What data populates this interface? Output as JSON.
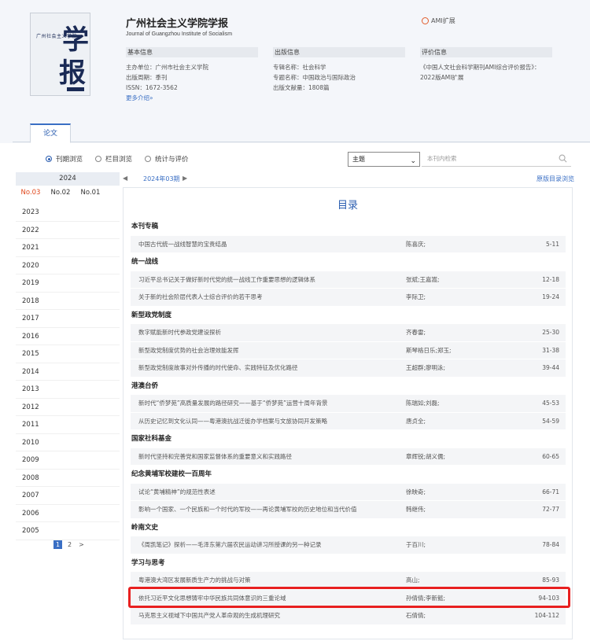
{
  "journal": {
    "title": "广州社会主义学院学报",
    "subtitle": "Journal of Guangzhou Institute of Socialism",
    "cover_text": "广州社会主义学院",
    "cover_big1": "学",
    "cover_big2": "报",
    "ami_label": "AMI扩展"
  },
  "info": {
    "basic": {
      "heading": "基本信息",
      "sponsor": "主办单位：广州市社会主义学院",
      "cycle": "出版周期：季刊",
      "issn": "ISSN：1672-3562",
      "more": "更多介绍»"
    },
    "publish": {
      "heading": "出版信息",
      "field": "专辑名称：社会科学",
      "topic": "专题名称：中国政治与国际政治",
      "count": "出版文献量：1808篇"
    },
    "eval": {
      "heading": "评价信息",
      "line1": "《中国人文社会科学期刊AMI综合评价报告》：",
      "line2": "2022版AMI扩展"
    }
  },
  "tabs": {
    "papers": "论文"
  },
  "view_options": {
    "by_issue": "刊期浏览",
    "by_column": "栏目浏览",
    "stats": "统计与评价"
  },
  "search": {
    "select_value": "主题",
    "placeholder": "本刊内检索"
  },
  "years": {
    "current": "2024",
    "issues": [
      "No.03",
      "No.02",
      "No.01"
    ],
    "list": [
      "2023",
      "2022",
      "2021",
      "2020",
      "2019",
      "2018",
      "2017",
      "2016",
      "2015",
      "2014",
      "2013",
      "2012",
      "2011",
      "2010",
      "2009",
      "2008",
      "2007",
      "2006",
      "2005"
    ],
    "pages": [
      "1",
      "2",
      ">"
    ]
  },
  "issue_nav": {
    "prev": "◀",
    "current": "2024年03期",
    "next": "▶",
    "original": "原版目录浏览"
  },
  "toc": {
    "title": "目录",
    "sections": [
      {
        "name": "本刊专稿",
        "articles": [
          {
            "title": "中国古代统一战线智慧的宝贵结晶",
            "authors": "陈喜庆;",
            "pages": "5-11"
          }
        ]
      },
      {
        "name": "统一战线",
        "articles": [
          {
            "title": "习近平总书记关于做好新时代党的统一战线工作重要思想的逻辑体系",
            "authors": "张斌;王嘉嵩;",
            "pages": "12-18"
          },
          {
            "title": "关于新的社会阶层代表人士综合评价的若干思考",
            "authors": "李际卫;",
            "pages": "19-24"
          }
        ]
      },
      {
        "name": "新型政党制度",
        "articles": [
          {
            "title": "数字赋能新时代参政党建设探析",
            "authors": "齐春雷;",
            "pages": "25-30"
          },
          {
            "title": "新型政党制度优势的社会治理效能发挥",
            "authors": "斯琴格日乐;郑玉;",
            "pages": "31-38"
          },
          {
            "title": "新型政党制度故事对外传播的时代使命、实践特征及优化路径",
            "authors": "王超群;廖明泳;",
            "pages": "39-44"
          }
        ]
      },
      {
        "name": "港澳台侨",
        "articles": [
          {
            "title": "新时代“侨梦苑”高质量发展的路径研究——基于“侨梦苑”运营十周年背景",
            "authors": "陈瑞如;刘磊;",
            "pages": "45-53"
          },
          {
            "title": "从历史记忆到文化认同——粤港澳抗战迁徙办学档案与文旅协同开发策略",
            "authors": "唐贞全;",
            "pages": "54-59"
          }
        ]
      },
      {
        "name": "国家社科基金",
        "articles": [
          {
            "title": "新时代坚持和完善党和国家监督体系的重要意义和实践路径",
            "authors": "章辉锐;胡义儒;",
            "pages": "60-65"
          }
        ]
      },
      {
        "name": "纪念黄埔军校建校一百周年",
        "articles": [
          {
            "title": "试论“黄埔精神”的规范性表述",
            "authors": "徐映奇;",
            "pages": "66-71"
          },
          {
            "title": "影响一个国家、一个民族和一个时代的军校——再论黄埔军校的历史地位和当代价值",
            "authors": "韩继伟;",
            "pages": "72-77"
          }
        ]
      },
      {
        "name": "岭南文史",
        "articles": [
          {
            "title": "《周凯笔记》探析——毛泽东第六届农民运动讲习所授课的另一种记录",
            "authors": "于百川;",
            "pages": "78-84"
          }
        ]
      },
      {
        "name": "学习与思考",
        "articles": [
          {
            "title": "粤港澳大湾区发展新质生产力的挑战与对策",
            "authors": "高山;",
            "pages": "85-93"
          },
          {
            "title": "依托习近平文化思想铸牢中华民族共同体意识的三重论域",
            "authors": "孙倩倩;李新懿;",
            "pages": "94-103"
          },
          {
            "title": "马克思主义视域下中国共产党人革命观的生成机理研究",
            "authors": "石倩倩;",
            "pages": "104-112"
          }
        ]
      }
    ]
  }
}
